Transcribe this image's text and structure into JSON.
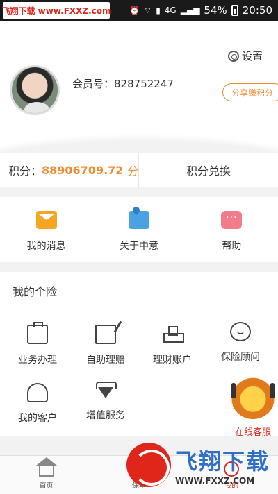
{
  "status_bar": {
    "watermark": "飞翔下载 www.FXXZ.com",
    "network_label": "4G",
    "battery_percent": "54%",
    "time": "20:50"
  },
  "header": {
    "settings_label": "设置",
    "member_prefix": "会员号：",
    "member_id": "828752247",
    "share_button": "分享赚积分"
  },
  "points": {
    "label": "积分：",
    "value": "88906709.72",
    "unit": "分",
    "exchange": "积分兑换"
  },
  "quick_links": [
    {
      "label": "我的消息",
      "icon": "envelope-icon"
    },
    {
      "label": "关于中意",
      "icon": "map-pin-icon"
    },
    {
      "label": "帮助",
      "icon": "chat-bubble-icon"
    }
  ],
  "insurance": {
    "title": "我的个险",
    "items": [
      {
        "label": "业务办理",
        "icon": "briefcase-icon"
      },
      {
        "label": "自助理赔",
        "icon": "pen-paper-icon"
      },
      {
        "label": "理财账户",
        "icon": "stacked-coins-icon"
      },
      {
        "label": "保险顾问",
        "icon": "advisor-headset-icon"
      },
      {
        "label": "我的客户",
        "icon": "customers-icon"
      },
      {
        "label": "增值服务",
        "icon": "diamond-icon"
      }
    ]
  },
  "online_service": {
    "label": "在线客服",
    "icon": "lion-mascot-icon"
  },
  "tab_bar": {
    "tabs": [
      {
        "label": "首页",
        "icon": "home-icon",
        "active": false
      },
      {
        "label": "保单",
        "icon": "policy-icon",
        "active": false
      },
      {
        "label": "我的",
        "icon": "person-icon",
        "active": true
      }
    ]
  },
  "watermark": {
    "cn": "飞翔下载",
    "url": "WWW.FXXZ.COM"
  },
  "colors": {
    "accent": "#f08a30",
    "active_tab": "#e0261b",
    "watermark_blue": "#2f6fc6"
  }
}
